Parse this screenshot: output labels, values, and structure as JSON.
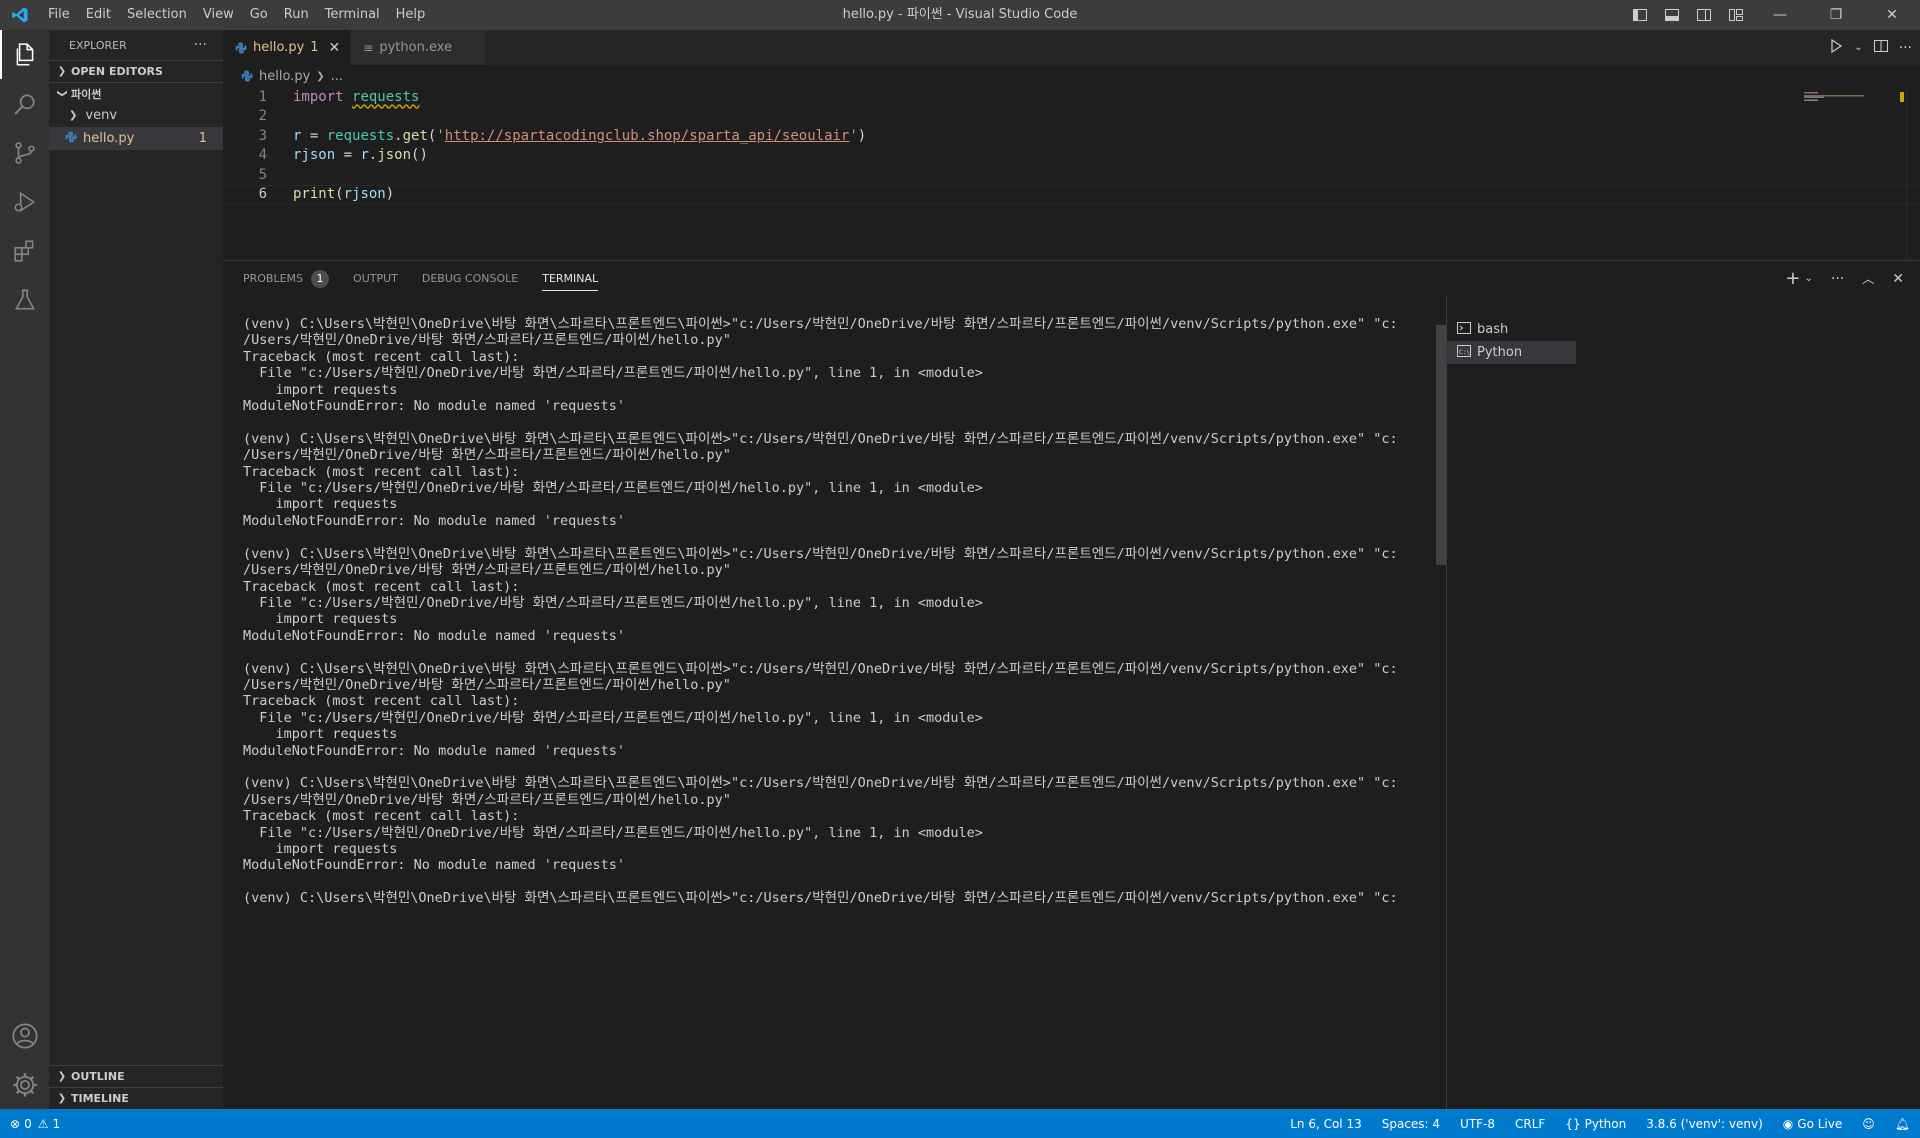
{
  "window": {
    "title": "hello.py - 파이썬 - Visual Studio Code",
    "menu": [
      "File",
      "Edit",
      "Selection",
      "View",
      "Go",
      "Run",
      "Terminal",
      "Help"
    ]
  },
  "sidebar": {
    "title": "EXPLORER",
    "open_editors": "OPEN EDITORS",
    "folder": "파이썬",
    "items": [
      {
        "label": "venv"
      },
      {
        "label": "hello.py",
        "badge": "1"
      }
    ],
    "outline": "OUTLINE",
    "timeline": "TIMELINE"
  },
  "tabs": [
    {
      "label": "hello.py",
      "badge": "1"
    },
    {
      "label": "python.exe"
    }
  ],
  "breadcrumb": {
    "file": "hello.py",
    "rest": "..."
  },
  "code": {
    "line_numbers": [
      "1",
      "2",
      "3",
      "4",
      "5",
      "6"
    ],
    "url": "http://spartacodingclub.shop/sparta_api/seoulair"
  },
  "panel": {
    "tabs": [
      "PROBLEMS",
      "OUTPUT",
      "DEBUG CONSOLE",
      "TERMINAL"
    ],
    "problems_count": "1",
    "terminal_text": "(venv) C:\\Users\\박현민\\OneDrive\\바탕 화면\\스파르타\\프론트엔드\\파이썬>\"c:/Users/박현민/OneDrive/바탕 화면/스파르타/프론트엔드/파이썬/venv/Scripts/python.exe\" \"c:\n/Users/박현민/OneDrive/바탕 화면/스파르타/프론트엔드/파이썬/hello.py\"\nTraceback (most recent call last):\n  File \"c:/Users/박현민/OneDrive/바탕 화면/스파르타/프론트엔드/파이썬/hello.py\", line 1, in <module>\n    import requests\nModuleNotFoundError: No module named 'requests'\n\n(venv) C:\\Users\\박현민\\OneDrive\\바탕 화면\\스파르타\\프론트엔드\\파이썬>\"c:/Users/박현민/OneDrive/바탕 화면/스파르타/프론트엔드/파이썬/venv/Scripts/python.exe\" \"c:\n/Users/박현민/OneDrive/바탕 화면/스파르타/프론트엔드/파이썬/hello.py\"\nTraceback (most recent call last):\n  File \"c:/Users/박현민/OneDrive/바탕 화면/스파르타/프론트엔드/파이썬/hello.py\", line 1, in <module>\n    import requests\nModuleNotFoundError: No module named 'requests'\n\n(venv) C:\\Users\\박현민\\OneDrive\\바탕 화면\\스파르타\\프론트엔드\\파이썬>\"c:/Users/박현민/OneDrive/바탕 화면/스파르타/프론트엔드/파이썬/venv/Scripts/python.exe\" \"c:\n/Users/박현민/OneDrive/바탕 화면/스파르타/프론트엔드/파이썬/hello.py\"\nTraceback (most recent call last):\n  File \"c:/Users/박현민/OneDrive/바탕 화면/스파르타/프론트엔드/파이썬/hello.py\", line 1, in <module>\n    import requests\nModuleNotFoundError: No module named 'requests'\n\n(venv) C:\\Users\\박현민\\OneDrive\\바탕 화면\\스파르타\\프론트엔드\\파이썬>\"c:/Users/박현민/OneDrive/바탕 화면/스파르타/프론트엔드/파이썬/venv/Scripts/python.exe\" \"c:\n/Users/박현민/OneDrive/바탕 화면/스파르타/프론트엔드/파이썬/hello.py\"\nTraceback (most recent call last):\n  File \"c:/Users/박현민/OneDrive/바탕 화면/스파르타/프론트엔드/파이썬/hello.py\", line 1, in <module>\n    import requests\nModuleNotFoundError: No module named 'requests'\n\n(venv) C:\\Users\\박현민\\OneDrive\\바탕 화면\\스파르타\\프론트엔드\\파이썬>\"c:/Users/박현민/OneDrive/바탕 화면/스파르타/프론트엔드/파이썬/venv/Scripts/python.exe\" \"c:\n/Users/박현민/OneDrive/바탕 화면/스파르타/프론트엔드/파이썬/hello.py\"\nTraceback (most recent call last):\n  File \"c:/Users/박현민/OneDrive/바탕 화면/스파르타/프론트엔드/파이썬/hello.py\", line 1, in <module>\n    import requests\nModuleNotFoundError: No module named 'requests'\n\n(venv) C:\\Users\\박현민\\OneDrive\\바탕 화면\\스파르타\\프론트엔드\\파이썬>\"c:/Users/박현민/OneDrive/바탕 화면/스파르타/프론트엔드/파이썬/venv/Scripts/python.exe\" \"c:",
    "terminals": [
      {
        "label": "bash"
      },
      {
        "label": "Python"
      }
    ]
  },
  "statusbar": {
    "errors": "0",
    "warnings": "1",
    "position": "Ln 6, Col 13",
    "spaces": "Spaces: 4",
    "encoding": "UTF-8",
    "eol": "CRLF",
    "language": "Python",
    "interpreter": "3.8.6 ('venv': venv)",
    "golive": "Go Live"
  },
  "colors": {
    "accent": "#007acc",
    "modified": "#e2c08d"
  }
}
